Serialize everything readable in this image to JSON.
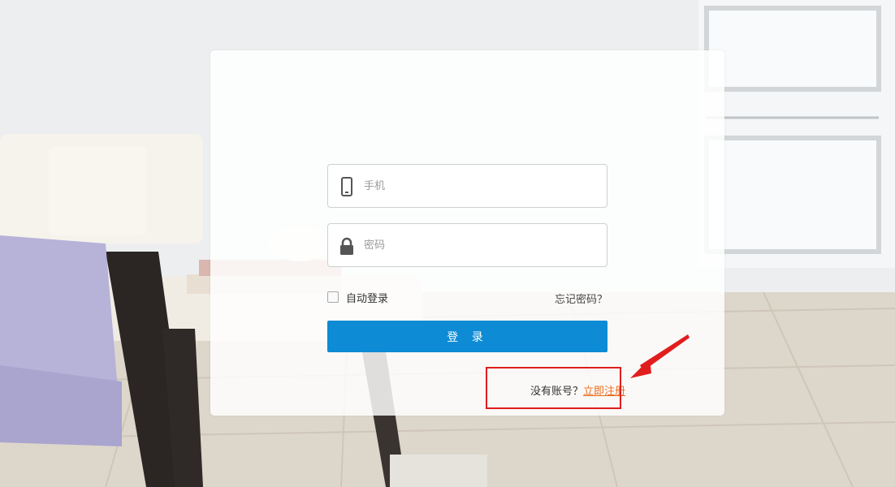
{
  "login": {
    "phone_placeholder": "手机",
    "password_placeholder": "密码",
    "remember_label": "自动登录",
    "forgot_label": "忘记密码？",
    "submit_label": "登 录",
    "no_account_text": "没有账号？",
    "register_label": "立即注册"
  },
  "icons": {
    "phone": "mobile-phone-icon",
    "password": "lock-icon",
    "annotation": "red-arrow-icon"
  },
  "colors": {
    "primary_button": "#0d8bd4",
    "register_link": "#ee6a1b",
    "highlight_box": "#e11d1d"
  }
}
